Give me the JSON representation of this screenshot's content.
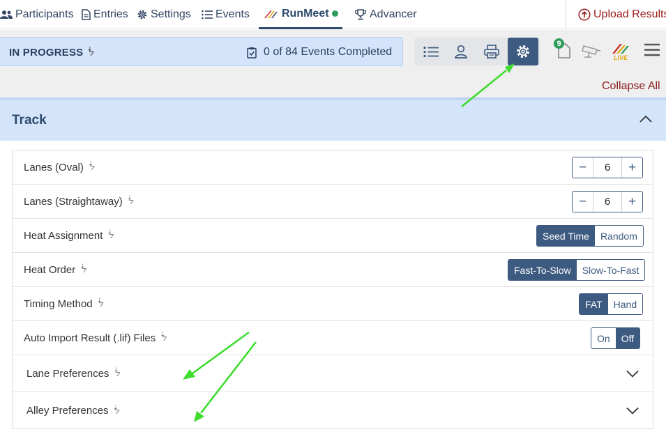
{
  "nav": {
    "participants": "Participants",
    "entries": "Entries",
    "settings": "Settings",
    "events": "Events",
    "brand": "RunMeet",
    "advancer": "Advancer",
    "upload": "Upload Results"
  },
  "status": {
    "label": "IN PROGRESS",
    "events_completed": "0 of 84 Events Completed"
  },
  "toolbar": {
    "badge_count": "9",
    "live_label": "LIVE",
    "collapse_all": "Collapse All"
  },
  "track": {
    "title": "Track",
    "rows": [
      {
        "label": "Lanes (Oval)",
        "value": "6"
      },
      {
        "label": "Lanes (Straightaway)",
        "value": "6"
      },
      {
        "label": "Heat Assignment",
        "options": [
          "Seed Time",
          "Random"
        ],
        "selected": "Seed Time"
      },
      {
        "label": "Heat Order",
        "options": [
          "Fast-To-Slow",
          "Slow-To-Fast"
        ],
        "selected": "Fast-To-Slow"
      },
      {
        "label": "Timing Method",
        "options": [
          "FAT",
          "Hand"
        ],
        "selected": "FAT"
      },
      {
        "label": "Auto Import Result (.lif) Files",
        "options": [
          "On",
          "Off"
        ],
        "selected": "Off"
      },
      {
        "label": "Lane Preferences"
      },
      {
        "label": "Alley Preferences"
      }
    ]
  },
  "colors": {
    "primary": "#3d5a80",
    "accent_red": "#8b1a1a",
    "success_green": "#2e9d5a",
    "annotation_arrow": "#3ddc2e",
    "header_blue": "#d4e5fb"
  }
}
